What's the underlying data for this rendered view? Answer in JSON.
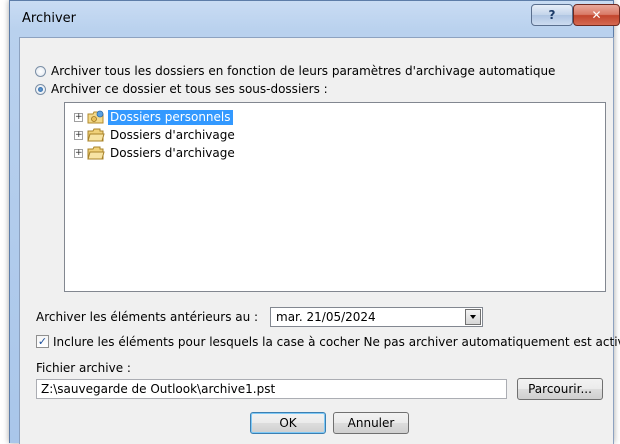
{
  "window": {
    "title": "Archiver",
    "help_label": "?",
    "close_label": "✕"
  },
  "options": {
    "archive_all_label": "Archiver tous les dossiers en fonction de leurs paramètres d'archivage automatique",
    "archive_folder_label": "Archiver ce dossier et tous ses sous-dossiers :",
    "selected": "archive_folder"
  },
  "tree": {
    "items": [
      {
        "label": "Dossiers personnels",
        "icon": "personal-folders-icon",
        "selected": true
      },
      {
        "label": "Dossiers d'archivage",
        "icon": "archive-folder-icon",
        "selected": false
      },
      {
        "label": "Dossiers d'archivage",
        "icon": "archive-folder-icon",
        "selected": false
      }
    ],
    "expander_glyph": "+"
  },
  "date": {
    "label": "Archiver les éléments antérieurs au :",
    "value": "mar. 21/05/2024"
  },
  "include": {
    "label": "Inclure les éléments pour lesquels la case à cocher Ne pas archiver automatiquement est activée",
    "checked": true,
    "check_glyph": "✓"
  },
  "file": {
    "label": "Fichier archive :",
    "value": "Z:\\sauvegarde de Outlook\\archive1.pst",
    "browse_label": "Parcourir..."
  },
  "buttons": {
    "ok_label": "OK",
    "cancel_label": "Annuler"
  },
  "colors": {
    "selection": "#3399ff",
    "frame": "#b9d1ee",
    "close": "#c2452d"
  }
}
